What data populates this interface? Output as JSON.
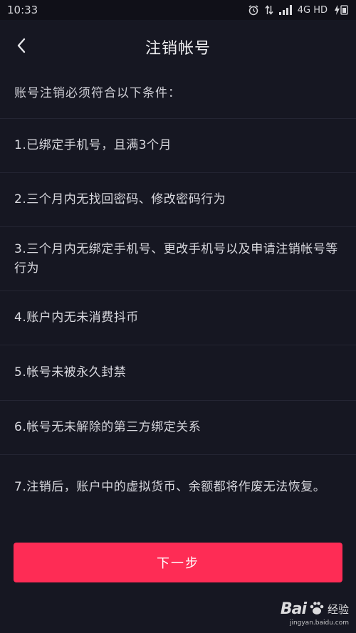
{
  "status_bar": {
    "time": "10:33",
    "network_label": "4G HD",
    "icons": [
      "alarm-icon",
      "data-arrows-icon",
      "signal-icon",
      "battery-charging-icon"
    ]
  },
  "nav": {
    "back_icon": "chevron-left-icon",
    "title": "注销帐号"
  },
  "intro": "账号注销必须符合以下条件：",
  "conditions": [
    "1.已绑定手机号，且满3个月",
    "2.三个月内无找回密码、修改密码行为",
    "3.三个月内无绑定手机号、更改手机号以及申请注销帐号等行为",
    "4.账户内无未消费抖币",
    "5.帐号未被永久封禁",
    "6.帐号无未解除的第三方绑定关系",
    "7.注销后，账户中的虚拟货币、余额都将作废无法恢复。"
  ],
  "next_button": {
    "label": "下一步"
  },
  "watermark": {
    "logo_text": "Bai",
    "logo_suffix": "经验",
    "url": "jingyan.baidu.com"
  },
  "colors": {
    "background": "#161722",
    "accent": "#fe2c55",
    "text": "#d8d8de"
  }
}
